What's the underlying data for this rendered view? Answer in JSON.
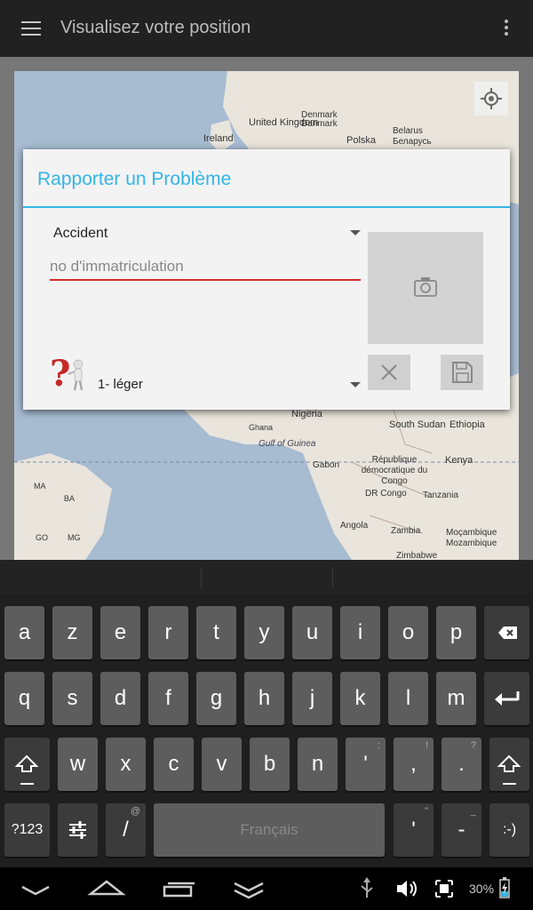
{
  "actionbar": {
    "title": "Visualisez votre position",
    "menu_icon": "hamburger-menu-icon",
    "overflow_icon": "overflow-menu-icon"
  },
  "map": {
    "labels": [
      "United Kingdom",
      "Ireland",
      "Denmark",
      "Danmark",
      "Polska",
      "Belarus",
      "Беларусь",
      "Nigeria",
      "Ghana",
      "Gulf of Guinea",
      "Gabon",
      "République démocratique du Congo",
      "DR Congo",
      "South Sudan",
      "Ethiopia",
      "Kenya",
      "Tanzania",
      "Angola",
      "Zambia",
      "Moçambique",
      "Mozambique",
      "Zimbabwe",
      "MA",
      "BA",
      "MG",
      "GO"
    ],
    "location_icon": "my-location-icon"
  },
  "dialog": {
    "title": "Rapporter un Problème",
    "type_value": "Accident",
    "plate_placeholder": "no d'immatriculation",
    "severity_value": "1- léger",
    "accent_color": "#33b5e5",
    "error_color": "#d32f2f"
  },
  "keyboard": {
    "row1": [
      "a",
      "z",
      "e",
      "r",
      "t",
      "y",
      "u",
      "i",
      "o",
      "p"
    ],
    "row2": [
      "q",
      "s",
      "d",
      "f",
      "g",
      "h",
      "j",
      "k",
      "l",
      "m"
    ],
    "row3": [
      "w",
      "x",
      "c",
      "v",
      "b",
      "n",
      "'",
      ",",
      "."
    ],
    "row3_hints": [
      "",
      "",
      "",
      "",
      "",
      "",
      ":",
      "!",
      "?"
    ],
    "mode_key": "?123",
    "slash_key": "/",
    "slash_hint": "@",
    "space_label": "Français",
    "apostrophe_key": "'",
    "apostrophe_hint": "\"",
    "dash_key": "-",
    "dash_hint": "_",
    "smiley_key": ":-)"
  },
  "statusbar": {
    "battery": "30%"
  }
}
